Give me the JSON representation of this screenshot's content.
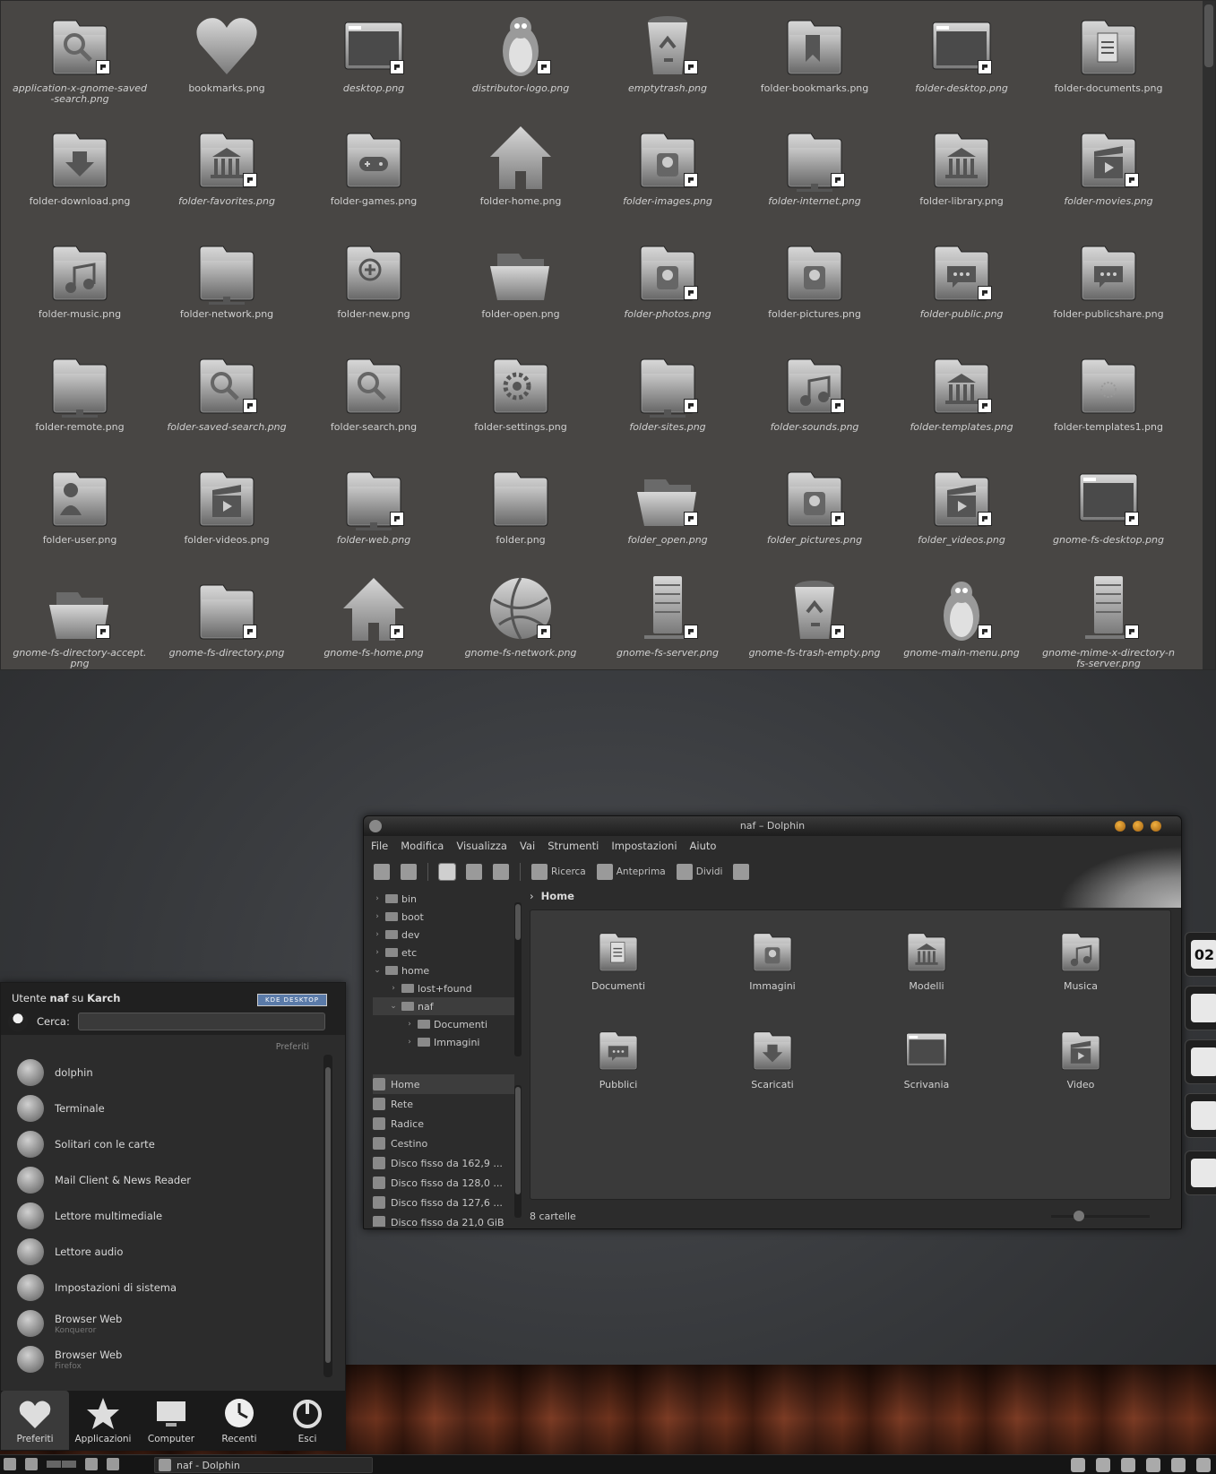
{
  "icon_grid": {
    "items": [
      {
        "label": "application-x-gnome-saved-search.png",
        "icon": "magnifier-folder-icon",
        "link": true
      },
      {
        "label": "bookmarks.png",
        "icon": "heart-icon",
        "link": false
      },
      {
        "label": "desktop.png",
        "icon": "desktop-window-icon",
        "link": true
      },
      {
        "label": "distributor-logo.png",
        "icon": "tux-penguin-icon",
        "link": true
      },
      {
        "label": "emptytrash.png",
        "icon": "trash-recycle-icon",
        "link": true
      },
      {
        "label": "folder-bookmarks.png",
        "icon": "bookmark-folder-icon",
        "link": false
      },
      {
        "label": "folder-desktop.png",
        "icon": "desktop-window-icon",
        "link": true
      },
      {
        "label": "folder-documents.png",
        "icon": "document-folder-icon",
        "link": false
      },
      {
        "label": "folder-download.png",
        "icon": "download-folder-icon",
        "link": false
      },
      {
        "label": "folder-favorites.png",
        "icon": "library-folder-icon",
        "link": true
      },
      {
        "label": "folder-games.png",
        "icon": "gamepad-folder-icon",
        "link": false
      },
      {
        "label": "folder-home.png",
        "icon": "home-icon",
        "link": false
      },
      {
        "label": "folder-images.png",
        "icon": "image-folder-icon",
        "link": true
      },
      {
        "label": "folder-internet.png",
        "icon": "network-folder-icon",
        "link": true
      },
      {
        "label": "folder-library.png",
        "icon": "library-folder-icon",
        "link": false
      },
      {
        "label": "folder-movies.png",
        "icon": "movie-folder-icon",
        "link": true
      },
      {
        "label": "folder-music.png",
        "icon": "music-folder-icon",
        "link": false
      },
      {
        "label": "folder-network.png",
        "icon": "network-folder-icon",
        "link": false
      },
      {
        "label": "folder-new.png",
        "icon": "new-folder-icon",
        "link": false
      },
      {
        "label": "folder-open.png",
        "icon": "open-folder-icon",
        "link": false
      },
      {
        "label": "folder-photos.png",
        "icon": "image-folder-icon",
        "link": true
      },
      {
        "label": "folder-pictures.png",
        "icon": "image-folder-icon",
        "link": false
      },
      {
        "label": "folder-public.png",
        "icon": "public-folder-icon",
        "link": true
      },
      {
        "label": "folder-publicshare.png",
        "icon": "public-folder-icon",
        "link": false
      },
      {
        "label": "folder-remote.png",
        "icon": "network-folder-icon",
        "link": false
      },
      {
        "label": "folder-saved-search.png",
        "icon": "magnifier-folder-icon",
        "link": true
      },
      {
        "label": "folder-search.png",
        "icon": "magnifier-folder-icon",
        "link": false
      },
      {
        "label": "folder-settings.png",
        "icon": "settings-folder-icon",
        "link": false
      },
      {
        "label": "folder-sites.png",
        "icon": "network-folder-icon",
        "link": true
      },
      {
        "label": "folder-sounds.png",
        "icon": "music-folder-icon",
        "link": true
      },
      {
        "label": "folder-templates.png",
        "icon": "library-folder-icon",
        "link": true
      },
      {
        "label": "folder-templates1.png",
        "icon": "template-folder-icon",
        "link": false
      },
      {
        "label": "folder-user.png",
        "icon": "user-folder-icon",
        "link": false
      },
      {
        "label": "folder-videos.png",
        "icon": "movie-folder-icon",
        "link": false
      },
      {
        "label": "folder-web.png",
        "icon": "network-folder-icon",
        "link": true
      },
      {
        "label": "folder.png",
        "icon": "folder-icon",
        "link": false
      },
      {
        "label": "folder_open.png",
        "icon": "open-folder-icon",
        "link": true
      },
      {
        "label": "folder_pictures.png",
        "icon": "image-folder-icon",
        "link": true
      },
      {
        "label": "folder_videos.png",
        "icon": "movie-folder-icon",
        "link": true
      },
      {
        "label": "gnome-fs-desktop.png",
        "icon": "desktop-window-icon",
        "link": true
      },
      {
        "label": "gnome-fs-directory-accept.png",
        "icon": "open-folder-icon",
        "link": true
      },
      {
        "label": "gnome-fs-directory.png",
        "icon": "folder-icon",
        "link": true
      },
      {
        "label": "gnome-fs-home.png",
        "icon": "home-icon",
        "link": true
      },
      {
        "label": "gnome-fs-network.png",
        "icon": "globe-network-icon",
        "link": true
      },
      {
        "label": "gnome-fs-server.png",
        "icon": "server-icon",
        "link": true
      },
      {
        "label": "gnome-fs-trash-empty.png",
        "icon": "trash-recycle-icon",
        "link": true
      },
      {
        "label": "gnome-main-menu.png",
        "icon": "tux-penguin-icon",
        "link": true
      },
      {
        "label": "gnome-mime-x-directory-nfs-server.png",
        "icon": "server-icon",
        "link": true
      }
    ]
  },
  "dolphin": {
    "title": "naf – Dolphin",
    "menu": [
      "File",
      "Modifica",
      "Visualizza",
      "Vai",
      "Strumenti",
      "Impostazioni",
      "Aiuto"
    ],
    "toolbar": {
      "search": "Ricerca",
      "preview": "Anteprima",
      "split": "Dividi"
    },
    "folders": [
      {
        "label": "bin",
        "arrow": "›",
        "indent": 0
      },
      {
        "label": "boot",
        "arrow": "›",
        "indent": 0
      },
      {
        "label": "dev",
        "arrow": "›",
        "indent": 0
      },
      {
        "label": "etc",
        "arrow": "›",
        "indent": 0
      },
      {
        "label": "home",
        "arrow": "⌄",
        "indent": 0
      },
      {
        "label": "lost+found",
        "arrow": "›",
        "indent": 1
      },
      {
        "label": "naf",
        "arrow": "⌄",
        "indent": 1,
        "selected": true
      },
      {
        "label": "Documenti",
        "arrow": "›",
        "indent": 2
      },
      {
        "label": "Immagini",
        "arrow": "›",
        "indent": 2
      }
    ],
    "places": [
      {
        "label": "Home",
        "selected": true
      },
      {
        "label": "Rete"
      },
      {
        "label": "Radice"
      },
      {
        "label": "Cestino"
      },
      {
        "label": "Disco fisso da 162,9 ..."
      },
      {
        "label": "Disco fisso da 128,0 ..."
      },
      {
        "label": "Disco fisso da 127,6 ..."
      },
      {
        "label": "Disco fisso da 21,0 GiB"
      }
    ],
    "breadcrumb": {
      "separator": "›",
      "current": "Home"
    },
    "content": [
      {
        "label": "Documenti",
        "icon": "document-folder-icon"
      },
      {
        "label": "Immagini",
        "icon": "image-folder-icon"
      },
      {
        "label": "Modelli",
        "icon": "library-folder-icon"
      },
      {
        "label": "Musica",
        "icon": "music-folder-icon"
      },
      {
        "label": "Pubblici",
        "icon": "public-folder-icon"
      },
      {
        "label": "Scaricati",
        "icon": "download-folder-icon"
      },
      {
        "label": "Scrivania",
        "icon": "desktop-window-icon"
      },
      {
        "label": "Video",
        "icon": "movie-folder-icon"
      }
    ],
    "status": "8 cartelle",
    "zoom_level": 0.25
  },
  "plasmoids": [
    {
      "name": "clock-plasmoid",
      "text": "02"
    },
    {
      "name": "system-monitor-plasmoid",
      "text": ""
    },
    {
      "name": "pie-chart-plasmoid",
      "text": ""
    },
    {
      "name": "settings-plasmoid",
      "text": ""
    },
    {
      "name": "wifi-plasmoid",
      "text": ""
    }
  ],
  "kickoff": {
    "user_prefix": "Utente",
    "user": "naf",
    "host_prefix": "su",
    "host": "Karch",
    "kde_badge": "KDE DESKTOP",
    "search_label": "Cerca:",
    "search_value": "",
    "section": "Preferiti",
    "favorites": [
      {
        "label": "dolphin",
        "sub": ""
      },
      {
        "label": "Terminale",
        "sub": ""
      },
      {
        "label": "Solitari con le carte",
        "sub": ""
      },
      {
        "label": "Mail Client & News Reader",
        "sub": ""
      },
      {
        "label": "Lettore multimediale",
        "sub": ""
      },
      {
        "label": "Lettore audio",
        "sub": ""
      },
      {
        "label": "Impostazioni di sistema",
        "sub": ""
      },
      {
        "label": "Browser Web",
        "sub": "Konqueror"
      },
      {
        "label": "Browser Web",
        "sub": "Firefox"
      }
    ],
    "tabs": [
      {
        "label": "Preferiti",
        "icon": "heart-icon",
        "selected": true
      },
      {
        "label": "Applicazioni",
        "icon": "star-icon"
      },
      {
        "label": "Computer",
        "icon": "computer-icon"
      },
      {
        "label": "Recenti",
        "icon": "clock-icon"
      },
      {
        "label": "Esci",
        "icon": "power-icon"
      }
    ]
  },
  "taskbar": {
    "task_label": "naf - Dolphin"
  }
}
